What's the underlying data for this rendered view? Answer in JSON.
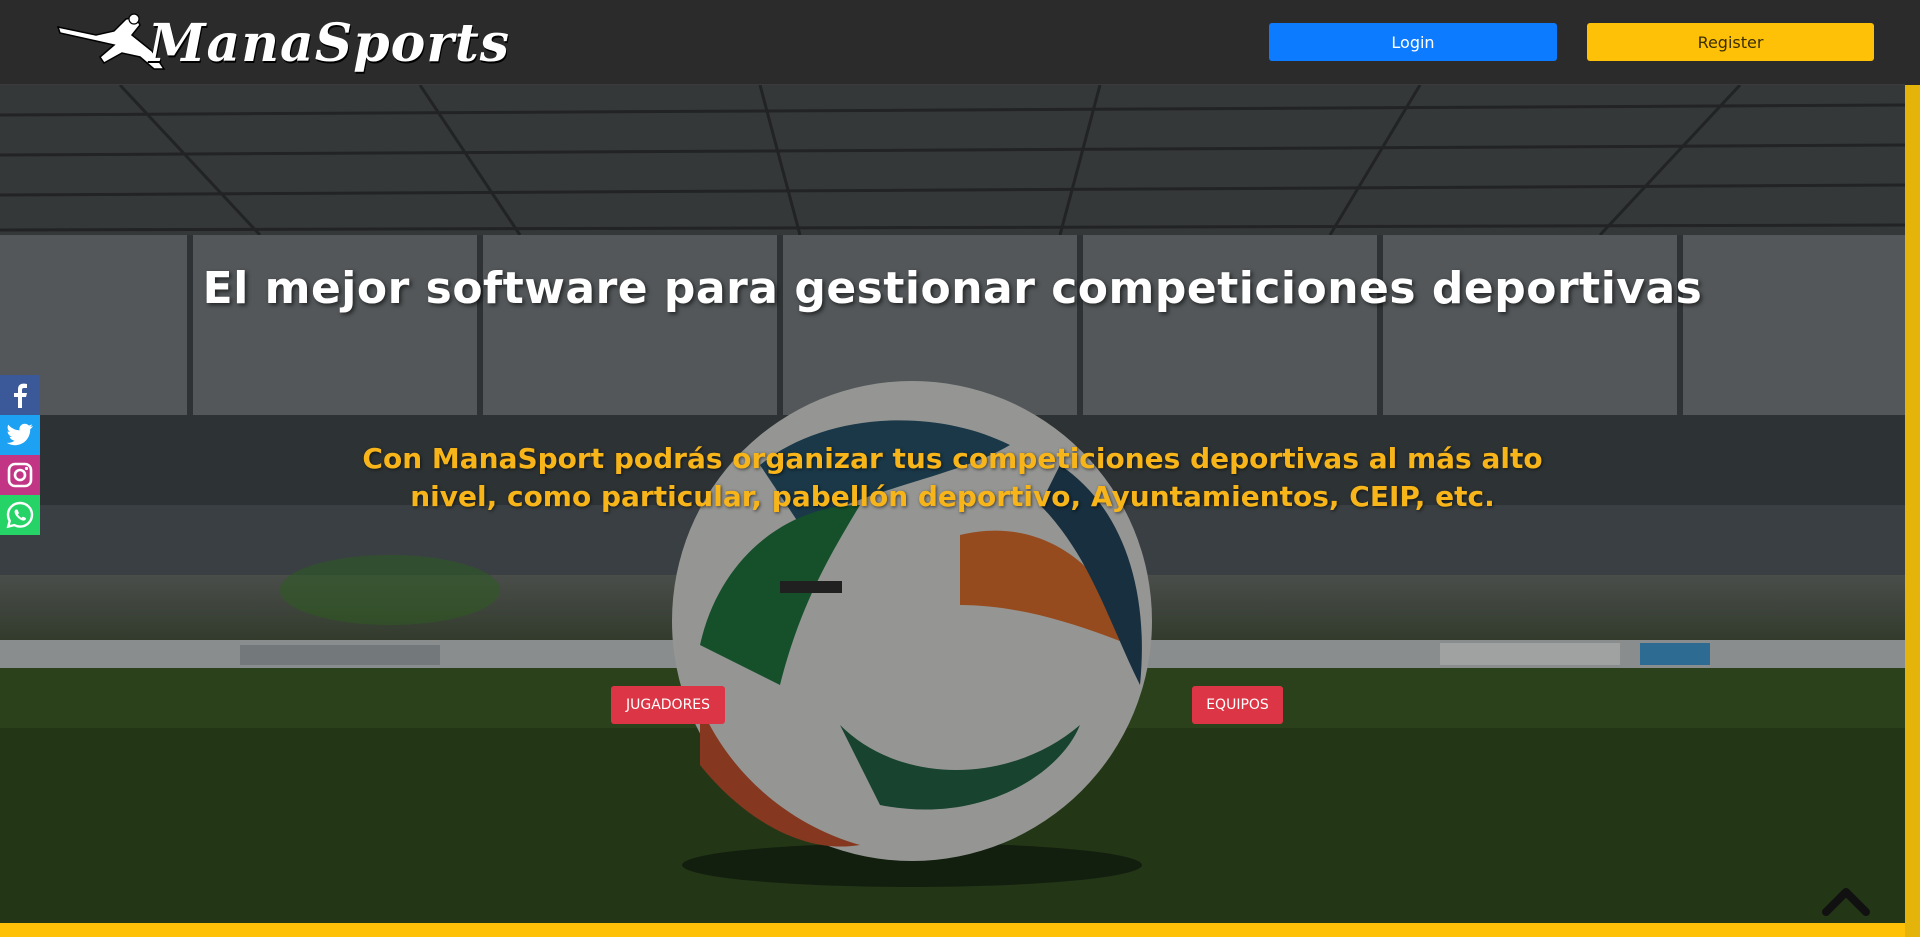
{
  "header": {
    "brand": "ManaSports",
    "login_label": "Login",
    "register_label": "Register"
  },
  "hero": {
    "title": "El mejor software para gestionar competiciones deportivas",
    "subtitle_line1": "Con ManaSport podrás organizar tus competiciones deportivas al más alto",
    "subtitle_line2": "nivel, como particular, pabellón deportivo, Ayuntamientos, CEIP, etc.",
    "button_players": "JUGADORES",
    "button_teams": "EQUIPOS"
  },
  "social": [
    {
      "icon": "facebook-icon",
      "color": "#3b5998"
    },
    {
      "icon": "twitter-icon",
      "color": "#1da1f2"
    },
    {
      "icon": "instagram-icon",
      "color": "#c13584"
    },
    {
      "icon": "whatsapp-icon",
      "color": "#25d366"
    }
  ],
  "colors": {
    "login": "#0d7bff",
    "register": "#ffc107",
    "accent_red": "#dc3545",
    "subtitle": "#f7b51a"
  }
}
